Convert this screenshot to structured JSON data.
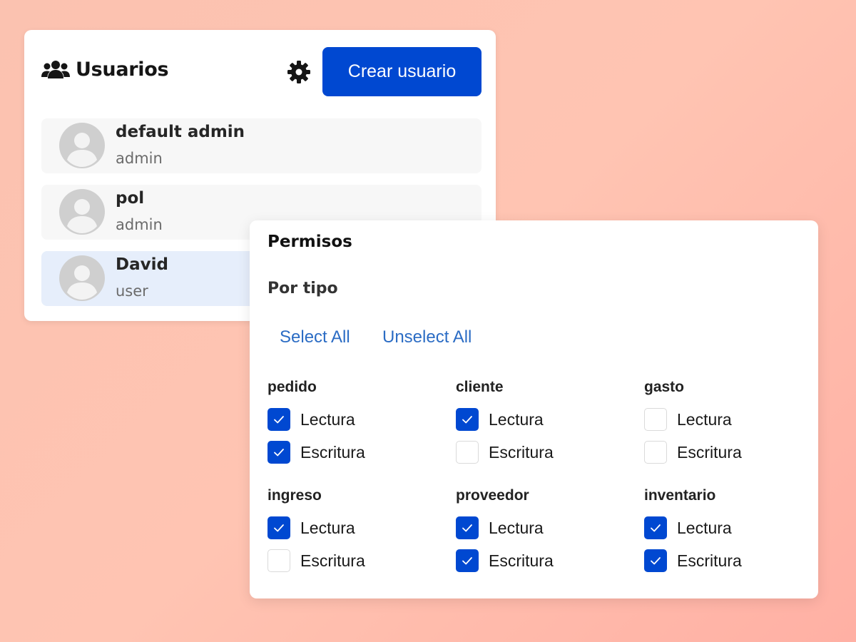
{
  "users_panel": {
    "title": "Usuarios",
    "create_button": "Crear usuario",
    "users": [
      {
        "name": "default admin",
        "role": "admin",
        "selected": false
      },
      {
        "name": "pol",
        "role": "admin",
        "selected": false
      },
      {
        "name": "David",
        "role": "user",
        "selected": true
      }
    ]
  },
  "permissions": {
    "title": "Permisos",
    "subtitle": "Por tipo",
    "select_all": "Select All",
    "unselect_all": "Unselect All",
    "groups": [
      {
        "name": "pedido",
        "read_label": "Lectura",
        "read": true,
        "write_label": "Escritura",
        "write": true
      },
      {
        "name": "cliente",
        "read_label": "Lectura",
        "read": true,
        "write_label": "Escritura",
        "write": false
      },
      {
        "name": "gasto",
        "read_label": "Lectura",
        "read": false,
        "write_label": "Escritura",
        "write": false
      },
      {
        "name": "ingreso",
        "read_label": "Lectura",
        "read": true,
        "write_label": "Escritura",
        "write": false
      },
      {
        "name": "proveedor",
        "read_label": "Lectura",
        "read": true,
        "write_label": "Escritura",
        "write": true
      },
      {
        "name": "inventario",
        "read_label": "Lectura",
        "read": true,
        "write_label": "Escritura",
        "write": true
      }
    ]
  },
  "colors": {
    "accent": "#0048d1",
    "link": "#2b6cc4",
    "selected_row": "#e6eefb"
  },
  "icons": {
    "title_icon": "users-icon",
    "settings_icon": "gear-icon",
    "avatar_icon": "user-avatar-icon",
    "check_icon": "check-icon"
  }
}
